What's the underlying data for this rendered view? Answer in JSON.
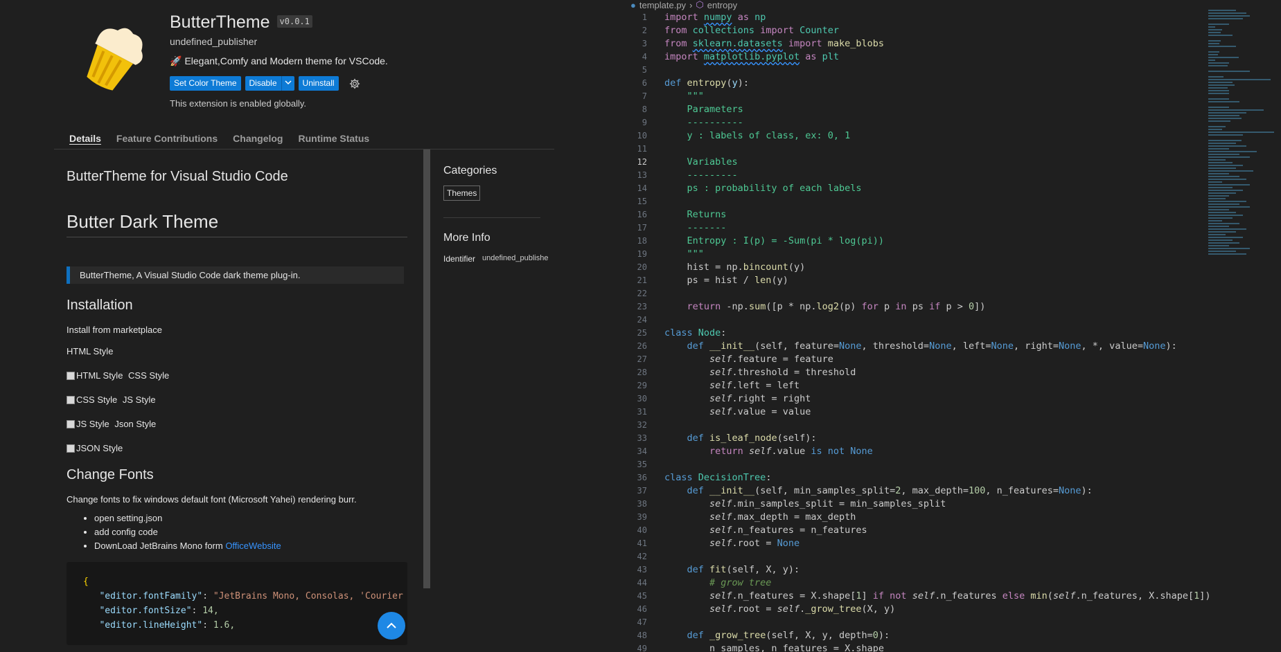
{
  "extension": {
    "name": "ButterTheme",
    "version": "v0.0.1",
    "publisher": "undefined_publisher",
    "description": "Elegant,Comfy and Modern theme for VSCode.",
    "actions": {
      "set_color_theme": "Set Color Theme",
      "disable": "Disable",
      "uninstall": "Uninstall"
    },
    "status": "This extension is enabled globally.",
    "tabs": [
      "Details",
      "Feature Contributions",
      "Changelog",
      "Runtime Status"
    ],
    "readme": {
      "title": "ButterTheme for Visual Studio Code",
      "heading": "Butter Dark Theme",
      "quote": "ButterTheme, A Visual Studio Code dark theme plug-in.",
      "installation_heading": "Installation",
      "install_text": "Install from marketplace",
      "html_style": "HTML Style",
      "img_alts": [
        {
          "alt": "HTML Style",
          "text": "CSS Style"
        },
        {
          "alt": "CSS Style",
          "text": "JS Style"
        },
        {
          "alt": "JS Style",
          "text": "Json Style"
        },
        {
          "alt": "JSON Style",
          "text": ""
        }
      ],
      "fonts_heading": "Change Fonts",
      "fonts_text": "Change fonts to fix windows default font (Microsoft Yahei) rendering burr.",
      "bullets": [
        "open setting.json",
        "add config code"
      ],
      "download_text": "DownLoad JetBrains Mono form ",
      "download_link": "OfficeWebsite",
      "code_lines": [
        {
          "open": "{"
        },
        {
          "key": "\"editor.fontFamily\"",
          "str": "\"JetBrains Mono, Consolas, 'Courier N"
        },
        {
          "key": "\"editor.fontSize\"",
          "num": "14,"
        },
        {
          "key": "\"editor.lineHeight\"",
          "num": "1.6,"
        }
      ]
    },
    "sidebar": {
      "categories_heading": "Categories",
      "category": "Themes",
      "more_info_heading": "More Info",
      "identifier_label": "Identifier",
      "identifier_value": "undefined_publishe"
    }
  },
  "editor": {
    "breadcrumb": {
      "file": "template.py",
      "symbol": "entropy"
    },
    "current_line": 12,
    "colors": {
      "keyword": "#569cd6",
      "control": "#c586c0",
      "function": "#dcdcaa",
      "class": "#4ec9b0",
      "docstring": "#4ec994",
      "number": "#b5cea8"
    }
  }
}
